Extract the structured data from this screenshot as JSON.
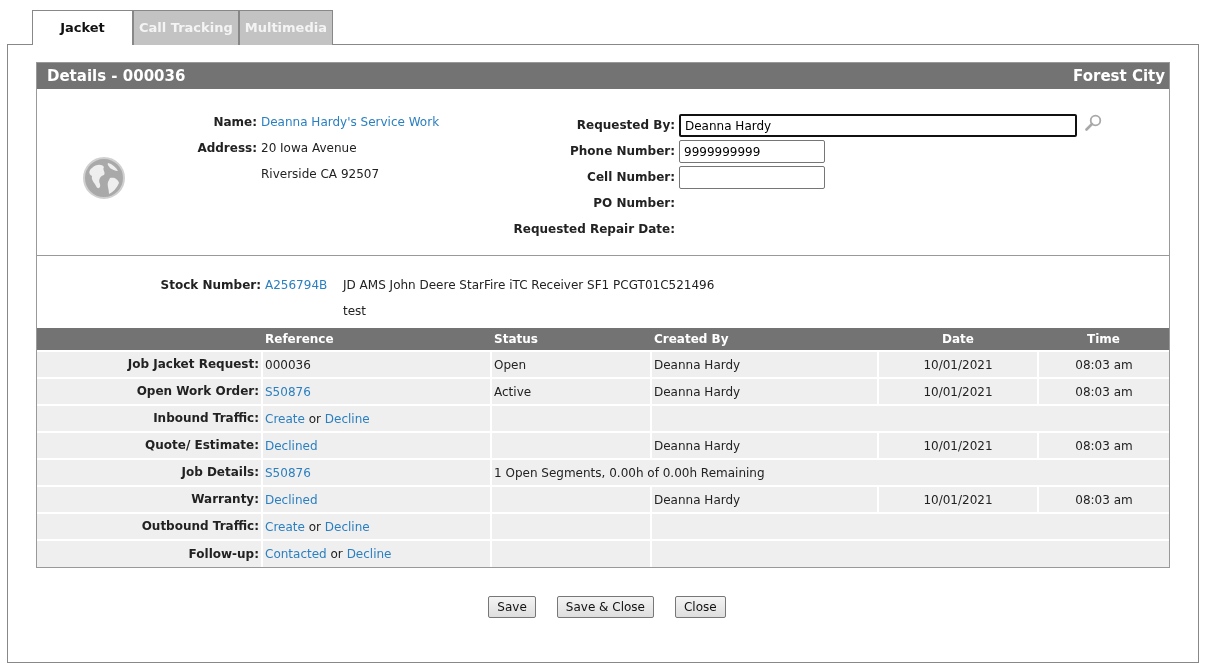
{
  "tabs": [
    {
      "label": "Jacket",
      "selected": true
    },
    {
      "label": "Call Tracking",
      "selected": false
    },
    {
      "label": "Multimedia",
      "selected": false
    }
  ],
  "details": {
    "title": "Details - 000036",
    "location": "Forest City",
    "left_fields": [
      {
        "label": "Name:",
        "kind": "link",
        "lines": [
          "Deanna Hardy's Service Work"
        ]
      },
      {
        "label": "Address:",
        "kind": "text",
        "lines": [
          "20 Iowa Avenue",
          "Riverside CA 92507"
        ]
      }
    ],
    "right_fields": [
      {
        "label": "Requested By:",
        "kind": "lookup",
        "value": "Deanna Hardy",
        "focused": true
      },
      {
        "label": "Phone Number:",
        "kind": "input",
        "value": "9999999999",
        "focused": false
      },
      {
        "label": "Cell Number:",
        "kind": "input",
        "focused": false
      },
      {
        "label": "PO Number:",
        "kind": "text"
      },
      {
        "label": "Requested Repair Date:",
        "kind": "text"
      }
    ],
    "stock": {
      "label": "Stock Number:",
      "number": "A256794B",
      "description": "JD AMS John Deere StarFire iTC Receiver SF1 PCGT01C521496",
      "note": "test"
    }
  },
  "table": {
    "columns": [
      "Reference",
      "Status",
      "Created By",
      "Date",
      "Time"
    ],
    "rows": [
      {
        "kind": "full",
        "label": "Job Jacket Request:",
        "reference": [
          {
            "text": "000036",
            "link": false
          }
        ],
        "status": "Open",
        "created_by": "Deanna Hardy",
        "date": "10/01/2021",
        "time": "08:03 am"
      },
      {
        "kind": "full",
        "label": "Open Work Order:",
        "reference": [
          {
            "text": "S50876",
            "link": true
          }
        ],
        "status": "Active",
        "created_by": "Deanna Hardy",
        "date": "10/01/2021",
        "time": "08:03 am"
      },
      {
        "kind": "pending",
        "label": "Inbound Traffic:",
        "reference": [
          {
            "text": "Create",
            "link": true
          },
          {
            "text": "or",
            "link": false
          },
          {
            "text": "Decline",
            "link": true
          }
        ]
      },
      {
        "kind": "full",
        "label": "Quote/ Estimate:",
        "reference": [
          {
            "text": "Declined",
            "link": true
          }
        ],
        "created_by": "Deanna Hardy",
        "date": "10/01/2021",
        "time": "08:03 am"
      },
      {
        "kind": "summary",
        "label": "Job Details:",
        "reference": [
          {
            "text": "S50876",
            "link": true
          }
        ],
        "status": "1 Open Segments, 0.00h of 0.00h Remaining"
      },
      {
        "kind": "full",
        "label": "Warranty:",
        "reference": [
          {
            "text": "Declined",
            "link": true
          }
        ],
        "created_by": "Deanna Hardy",
        "date": "10/01/2021",
        "time": "08:03 am"
      },
      {
        "kind": "pending",
        "label": "Outbound Traffic:",
        "reference": [
          {
            "text": "Create",
            "link": true
          },
          {
            "text": "or",
            "link": false
          },
          {
            "text": "Decline",
            "link": true
          }
        ]
      },
      {
        "kind": "pending",
        "label": "Follow-up:",
        "reference": [
          {
            "text": "Contacted",
            "link": true
          },
          {
            "text": "or",
            "link": false
          },
          {
            "text": "Decline",
            "link": true
          }
        ]
      }
    ]
  },
  "buttons": [
    "Save",
    "Save & Close",
    "Close"
  ]
}
